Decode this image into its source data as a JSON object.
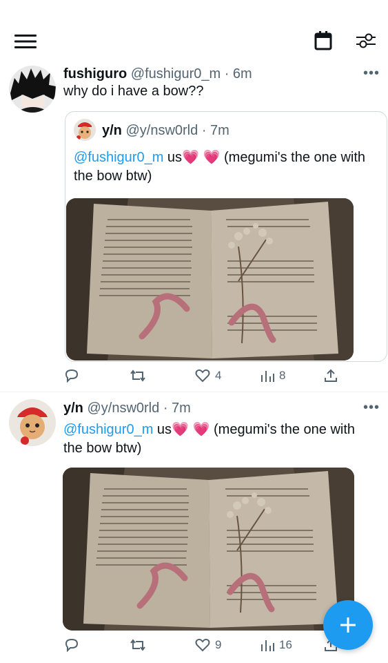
{
  "header": {
    "menu_icon": "hamburger-menu-icon",
    "calendar_icon": "calendar-icon",
    "filter_icon": "sliders-icon"
  },
  "tweets": [
    {
      "name": "fushiguro",
      "handle": "@fushigur0_m",
      "time": "· 6m",
      "text": "why do i have a bow??",
      "quote": {
        "name": "y/n",
        "handle": "@y/nsw0rld",
        "time": "· 7m",
        "mention": "@fushigur0_m",
        "text_after": " us",
        "hearts": "💗 💗",
        "text_rest": " (megumi's the one with the bow btw)"
      },
      "actions": {
        "reply": "",
        "retweet": "",
        "likes": "4",
        "views": "8"
      }
    },
    {
      "name": "y/n",
      "handle": "@y/nsw0rld",
      "time": "· 7m",
      "mention": "@fushigur0_m",
      "text_after": " us",
      "hearts": "💗 💗",
      "text_rest": " (megumi's the one with the bow btw)",
      "actions": {
        "reply": "",
        "retweet": "",
        "likes": "9",
        "views": "16"
      }
    }
  ],
  "fab_icon": "plus-icon",
  "colors": {
    "accent": "#1d9bf0",
    "secondary_text": "#536471",
    "heart": "#e8449b"
  }
}
